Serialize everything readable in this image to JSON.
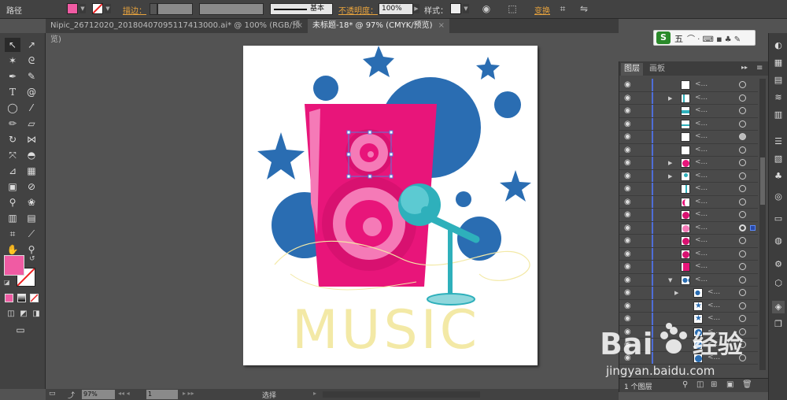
{
  "control_bar": {
    "object_type": "路径",
    "fill_color": "#f05ba3",
    "stroke_label": "描边：",
    "stroke_style": "基本",
    "opacity_label": "不透明度：",
    "opacity_value": "100%",
    "style_label": "样式：",
    "transform_label": "变换"
  },
  "tabs": [
    {
      "label": "Nipic_26712020_20180407095117413000.ai* @ 100% (RGB/预览)"
    },
    {
      "label": "未标题-18* @ 97% (CMYK/预览)"
    }
  ],
  "toolbar": {
    "fill_color": "#f05ba3",
    "tools": [
      "selection-tool",
      "direct-selection-tool",
      "magic-wand-tool",
      "lasso-tool",
      "pen-tool",
      "curvature-tool",
      "type-tool",
      "spiral-tool",
      "ellipse-tool",
      "paintbrush-tool",
      "pencil-tool",
      "eraser-tool",
      "rotate-tool",
      "width-tool",
      "free-transform-tool",
      "shape-builder-tool",
      "perspective-tool",
      "mesh-tool",
      "gradient-tool",
      "eyedropper-tool",
      "blend-tool",
      "symbol-sprayer-tool",
      "column-graph-tool",
      "artboard-tool",
      "slice-tool",
      "hand-tool",
      "zoom-tool"
    ]
  },
  "layers_panel": {
    "tabs": [
      "图层",
      "画板"
    ],
    "row_label": "<...",
    "footer_label": "1 个图层"
  },
  "status_bar": {
    "zoom": "97%",
    "page": "1",
    "tool_label": "选择"
  },
  "ime": {
    "mode_label": "五"
  },
  "artwork": {
    "text": "MUSIC",
    "colors": {
      "blue": "#2a6db2",
      "pink": "#e8157a",
      "light_pink": "#f57ab7",
      "teal": "#2eb0bb",
      "text_yellow": "#f3e9a6"
    }
  },
  "watermark": {
    "brand": "Baidu经验",
    "url": "jingyan.baidu.com"
  }
}
